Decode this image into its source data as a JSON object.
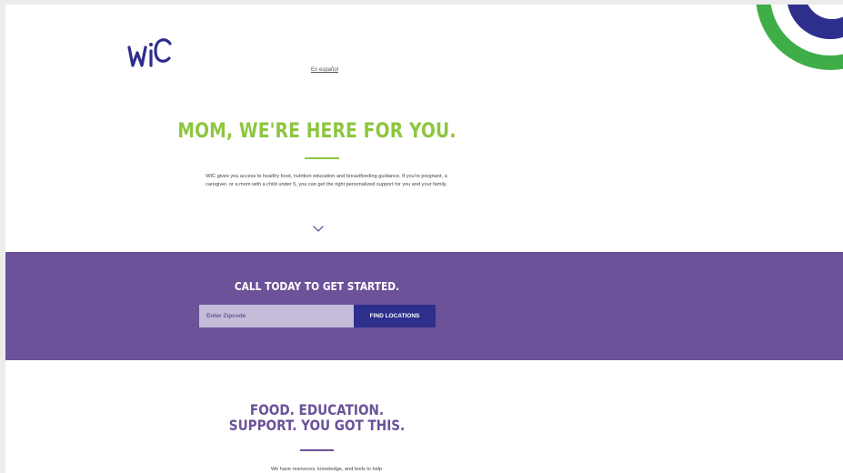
{
  "header": {
    "logo_text": "WIC",
    "lang_link": "En español"
  },
  "hero": {
    "title": "MOM, WE'RE HERE FOR YOU.",
    "body": "WIC gives you access to healthy food, nutrition education and breastfeeding guidance. If you're pregnant, a caregiver, or a mom with a child under 5, you can get the right personalized support for you and your family."
  },
  "cta": {
    "title": "CALL TODAY TO GET STARTED.",
    "zip_placeholder": "Enter Zipcode",
    "zip_value": "",
    "button_label": "FIND LOCATIONS"
  },
  "section2": {
    "title_line1": "FOOD. EDUCATION.",
    "title_line2": "SUPPORT. YOU GOT THIS.",
    "body": "We have resources, knowledge, and tools to help"
  },
  "colors": {
    "green": "#8dc63f",
    "purple": "#6b5299",
    "navy": "#2e2f8c",
    "input_bg": "#c5bcda",
    "deco_green": "#3fae49"
  },
  "icons": [
    "wic-logo-icon",
    "chevron-down-icon",
    "decorative-circles"
  ]
}
